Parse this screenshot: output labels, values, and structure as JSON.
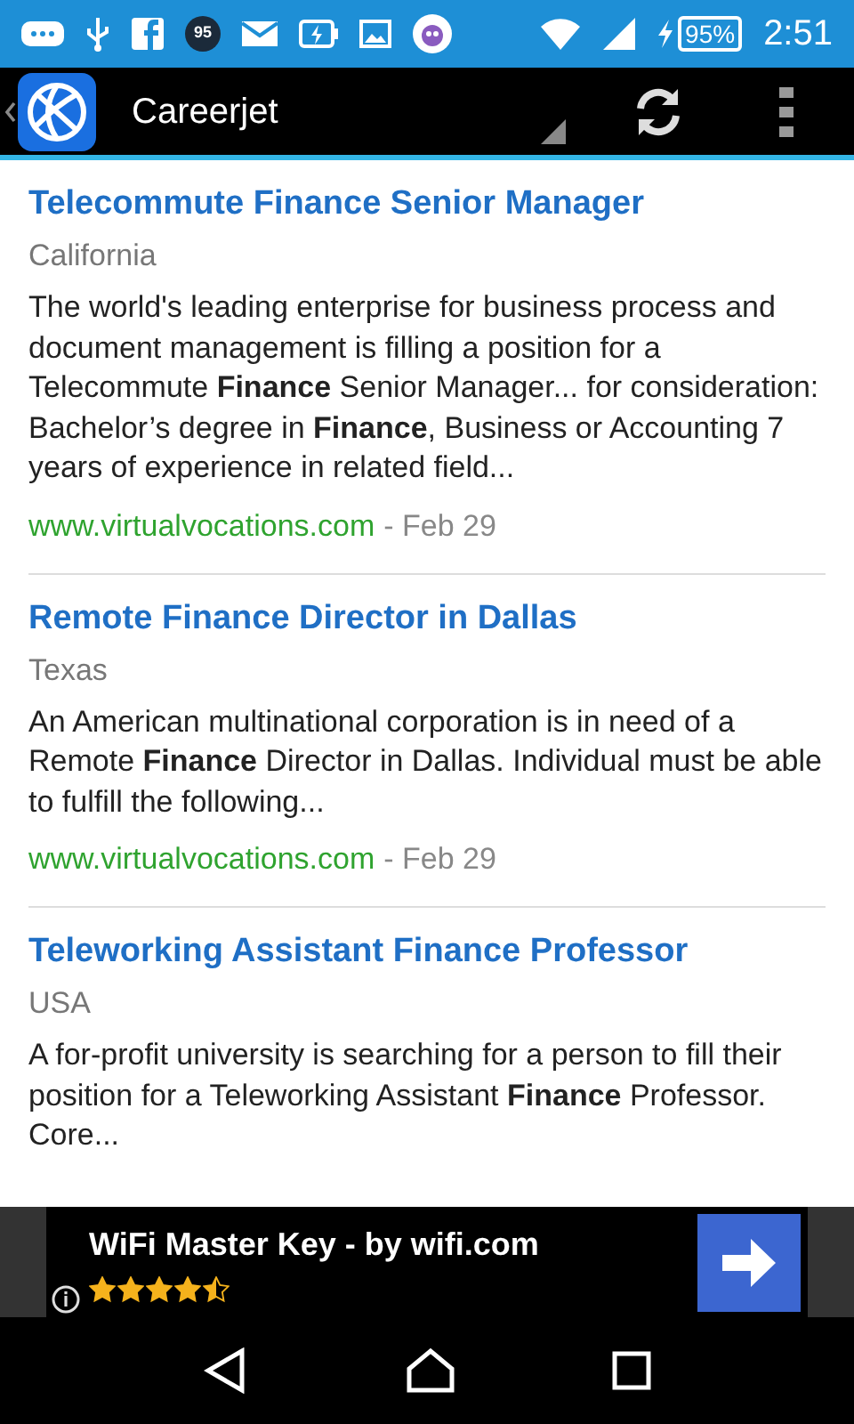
{
  "status_bar": {
    "badge": "95",
    "battery": "95%",
    "time": "2:51"
  },
  "app_bar": {
    "title": "Careerjet"
  },
  "jobs": [
    {
      "title": "Telecommute Finance Senior Manager",
      "location": "California",
      "description": "The world's leading enterprise for business process and document management is filling a position for a Telecommute **Finance** Senior Manager... for consideration: Bachelor’s degree in **Finance**, Business or Accounting 7 years of experience in related field...",
      "source": "www.virtualvocations.com",
      "date": "- Feb 29"
    },
    {
      "title": "Remote Finance Director in Dallas",
      "location": "Texas",
      "description": "An American multinational corporation is in need of a Remote **Finance** Director in Dallas. Individual must be able to fulfill the following...",
      "source": "www.virtualvocations.com",
      "date": "- Feb 29"
    },
    {
      "title": "Teleworking Assistant Finance Professor",
      "location": "USA",
      "description": "A for-profit university is searching for a person to fill their position for a Teleworking Assistant **Finance** Professor. Core..."
    }
  ],
  "ad": {
    "title": "WiFi Master Key - by wifi.com",
    "stars": 4.5
  }
}
